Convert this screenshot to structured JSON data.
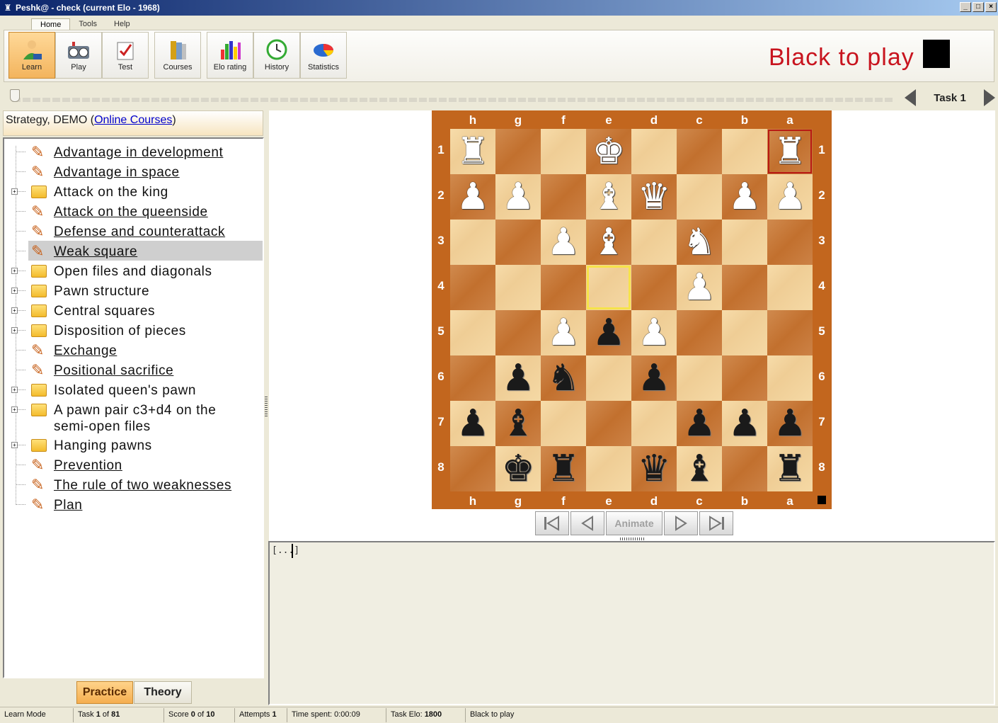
{
  "window": {
    "title": "Peshk@ - check (current Elo - 1968)"
  },
  "menu_tabs": [
    "Home",
    "Tools",
    "Help"
  ],
  "ribbon": {
    "buttons": [
      {
        "label": "Learn",
        "icon": "learn-icon",
        "active": true
      },
      {
        "label": "Play",
        "icon": "chess-clock-icon"
      },
      {
        "label": "Test",
        "icon": "test-icon"
      },
      {
        "label": "Courses",
        "icon": "books-icon"
      },
      {
        "label": "Elo rating",
        "icon": "bar-chart-icon"
      },
      {
        "label": "History",
        "icon": "clock-icon"
      },
      {
        "label": "Statistics",
        "icon": "pie-chart-icon"
      }
    ]
  },
  "to_play": "Black to play",
  "task_nav": {
    "label": "Task  1"
  },
  "panel": {
    "header_text": "Strategy, DEMO (",
    "header_link": "Online Courses",
    "header_close": ")"
  },
  "tree": [
    {
      "label": "Advantage in development",
      "type": "lesson"
    },
    {
      "label": "Advantage in space",
      "type": "lesson"
    },
    {
      "label": "Attack on the king",
      "type": "folder"
    },
    {
      "label": "Attack on the queenside",
      "type": "lesson"
    },
    {
      "label": "Defense and counterattack",
      "type": "lesson"
    },
    {
      "label": "Weak square",
      "type": "lesson",
      "selected": true
    },
    {
      "label": "Open files and diagonals",
      "type": "folder"
    },
    {
      "label": "Pawn structure",
      "type": "folder"
    },
    {
      "label": "Central squares",
      "type": "folder"
    },
    {
      "label": "Disposition of pieces",
      "type": "folder"
    },
    {
      "label": "Exchange",
      "type": "lesson"
    },
    {
      "label": "Positional sacrifice",
      "type": "lesson"
    },
    {
      "label": "Isolated queen's pawn",
      "type": "folder"
    },
    {
      "label": "A pawn pair c3+d4 on the",
      "label2": "semi-open files",
      "type": "folder"
    },
    {
      "label": "Hanging pawns",
      "type": "folder"
    },
    {
      "label": "Prevention",
      "type": "lesson"
    },
    {
      "label": "The rule of two weaknesses",
      "type": "lesson"
    },
    {
      "label": "Plan",
      "type": "lesson"
    }
  ],
  "left_tabs": {
    "practice": "Practice",
    "theory": "Theory"
  },
  "board": {
    "files": [
      "h",
      "g",
      "f",
      "e",
      "d",
      "c",
      "b",
      "a"
    ],
    "ranks": [
      "1",
      "2",
      "3",
      "4",
      "5",
      "6",
      "7",
      "8"
    ],
    "pieces": [
      {
        "sq": "h1",
        "p": "♜",
        "c": "w"
      },
      {
        "sq": "e1",
        "p": "♚",
        "c": "w"
      },
      {
        "sq": "a1",
        "p": "♜",
        "c": "w"
      },
      {
        "sq": "h2",
        "p": "♟",
        "c": "w"
      },
      {
        "sq": "g2",
        "p": "♟",
        "c": "w"
      },
      {
        "sq": "e2",
        "p": "♝",
        "c": "w"
      },
      {
        "sq": "d2",
        "p": "♛",
        "c": "w"
      },
      {
        "sq": "b2",
        "p": "♟",
        "c": "w"
      },
      {
        "sq": "a2",
        "p": "♟",
        "c": "w"
      },
      {
        "sq": "f3",
        "p": "♟",
        "c": "w"
      },
      {
        "sq": "e3",
        "p": "♝",
        "c": "w"
      },
      {
        "sq": "c3",
        "p": "♞",
        "c": "w"
      },
      {
        "sq": "c4",
        "p": "♟",
        "c": "w"
      },
      {
        "sq": "f5",
        "p": "♟",
        "c": "w"
      },
      {
        "sq": "e5",
        "p": "♟",
        "c": "b"
      },
      {
        "sq": "d5",
        "p": "♟",
        "c": "w"
      },
      {
        "sq": "g6",
        "p": "♟",
        "c": "b"
      },
      {
        "sq": "f6",
        "p": "♞",
        "c": "b"
      },
      {
        "sq": "d6",
        "p": "♟",
        "c": "b"
      },
      {
        "sq": "h7",
        "p": "♟",
        "c": "b"
      },
      {
        "sq": "g7",
        "p": "♝",
        "c": "b"
      },
      {
        "sq": "c7",
        "p": "♟",
        "c": "b"
      },
      {
        "sq": "b7",
        "p": "♟",
        "c": "b"
      },
      {
        "sq": "a7",
        "p": "♟",
        "c": "b"
      },
      {
        "sq": "g8",
        "p": "♚",
        "c": "b"
      },
      {
        "sq": "f8",
        "p": "♜",
        "c": "b"
      },
      {
        "sq": "d8",
        "p": "♛",
        "c": "b"
      },
      {
        "sq": "c8",
        "p": "♝",
        "c": "b"
      },
      {
        "sq": "a8",
        "p": "♜",
        "c": "b"
      }
    ],
    "highlight_last_move": "a1",
    "highlight_selected": "e4"
  },
  "animate_label": "Animate",
  "notes_text": "[...]",
  "status": {
    "mode": "Learn Mode",
    "task_prefix": "Task ",
    "task_num": "1",
    "task_of": " of ",
    "task_total": "81",
    "score_prefix": "Score ",
    "score": "0",
    "score_of": " of ",
    "score_total": "10",
    "attempts_prefix": "Attempts ",
    "attempts": "1",
    "time_spent": "Time spent: 0:00:09",
    "task_elo_prefix": "Task Elo: ",
    "task_elo": "1800",
    "to_play": "Black to play"
  }
}
